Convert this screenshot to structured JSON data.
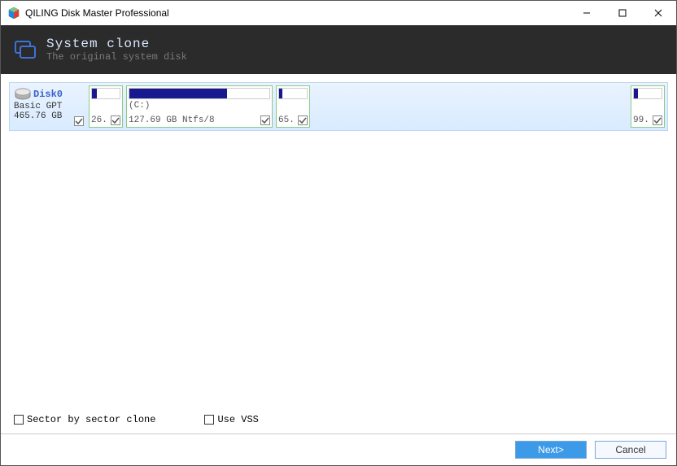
{
  "window": {
    "title": "QILING Disk Master Professional"
  },
  "header": {
    "title": "System clone",
    "subtitle": "The original system disk"
  },
  "disk": {
    "name": "Disk0",
    "type": "Basic GPT",
    "size": "465.76 GB"
  },
  "partitions": {
    "p1_size": "26.",
    "p2_label": "(C:)",
    "p2_detail": "127.69 GB Ntfs/8",
    "p3_size": "65.",
    "p4_size": "99."
  },
  "options": {
    "sector": "Sector by sector clone",
    "vss": "Use VSS"
  },
  "buttons": {
    "next": "Next>",
    "cancel": "Cancel"
  }
}
